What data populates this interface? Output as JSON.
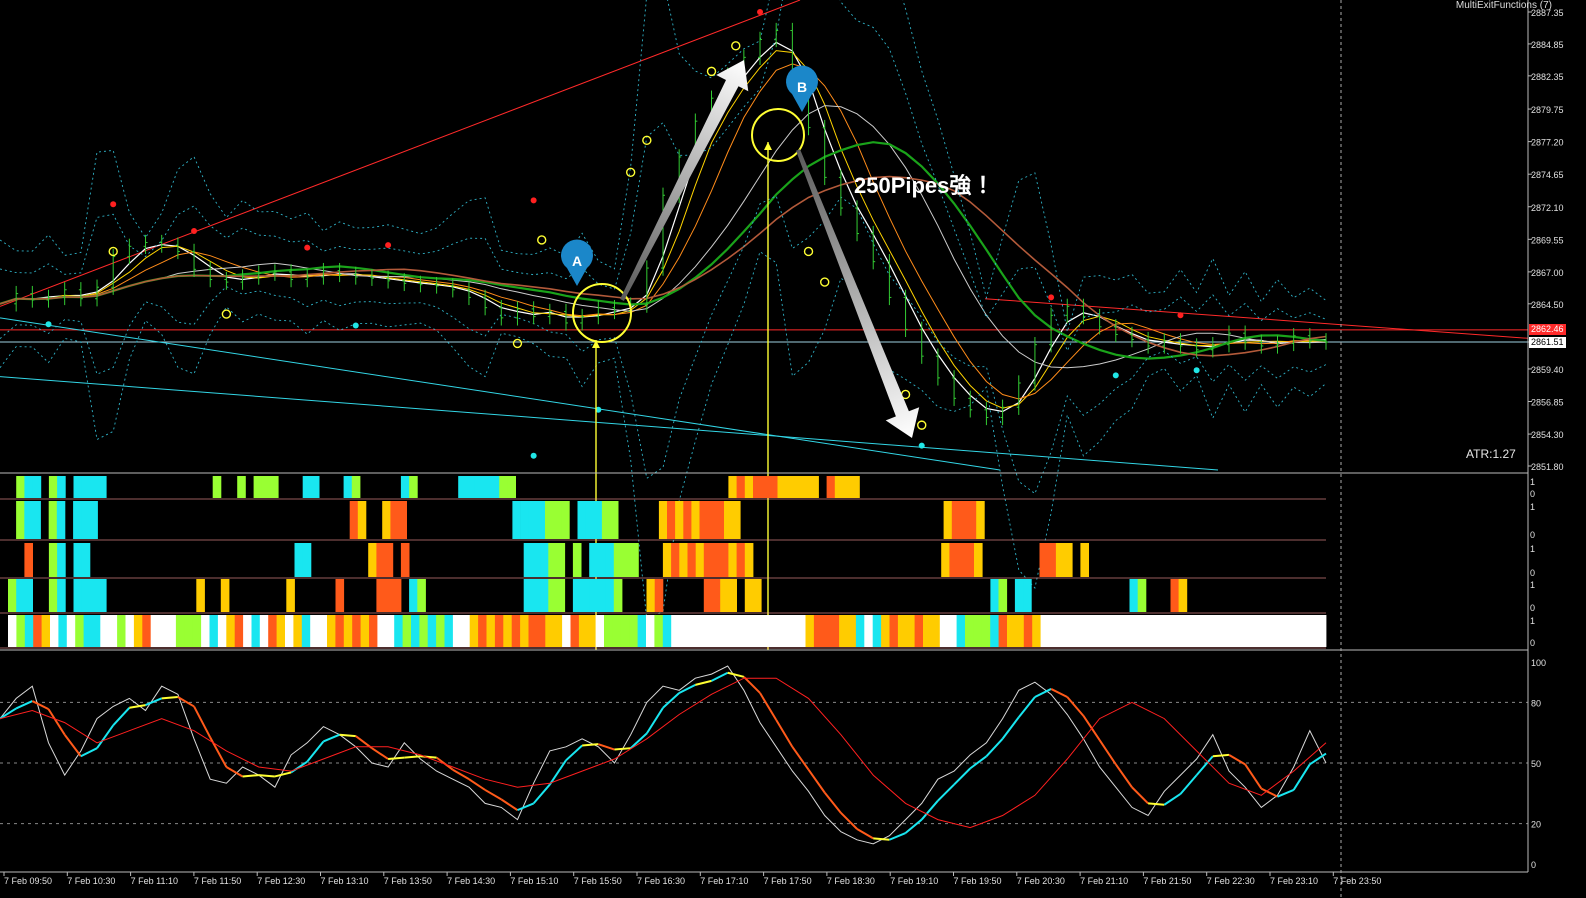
{
  "window": {
    "indicator_name": "MultiExitFunctions (7)",
    "atr_label": "ATR:1.27"
  },
  "annotations": {
    "main_text": "250Pipes強 ！",
    "pin_a": "A",
    "pin_b": "B"
  },
  "colors": {
    "background": "#000000",
    "candle": "#33cc33",
    "red_line": "#ff2a2a",
    "cyan_line": "#33d6e6",
    "yellow": "#ffff33",
    "orange": "#ff5a1a",
    "lime": "#99ff33",
    "gold": "#ffcc00"
  },
  "chart_data": [
    {
      "type": "line",
      "title": "",
      "y_axis_ticks": [
        "2887.35",
        "2884.85",
        "2882.35",
        "2879.75",
        "2877.20",
        "2874.65",
        "2872.10",
        "2869.55",
        "2867.00",
        "2864.50",
        "2861.51",
        "2859.40",
        "2856.85",
        "2854.30",
        "2851.80"
      ],
      "current_price_tags": [
        "2862.46",
        "2861.51"
      ],
      "ylim": [
        2851.8,
        2887.35
      ],
      "x_axis_ticks": [
        "7 Feb 09:50",
        "7 Feb 10:30",
        "7 Feb 11:10",
        "7 Feb 11:50",
        "7 Feb 12:30",
        "7 Feb 13:10",
        "7 Feb 13:50",
        "7 Feb 14:30",
        "7 Feb 15:10",
        "7 Feb 15:50",
        "7 Feb 16:30",
        "7 Feb 17:10",
        "7 Feb 17:50",
        "7 Feb 18:30",
        "7 Feb 19:10",
        "7 Feb 19:50",
        "7 Feb 20:30",
        "7 Feb 21:10",
        "7 Feb 21:50",
        "7 Feb 22:30",
        "7 Feb 23:10",
        "7 Feb 23:50"
      ],
      "series": [
        {
          "x": [
            0,
            4,
            8,
            12,
            16,
            20,
            24,
            28,
            32,
            36,
            40,
            44,
            48,
            52,
            56,
            60,
            64,
            68,
            72,
            76,
            80,
            84,
            88,
            92,
            96,
            100,
            104,
            108,
            112,
            116,
            120,
            124,
            128,
            132,
            136,
            140,
            144,
            148,
            152,
            156,
            160,
            164,
            168,
            172,
            176,
            180,
            184,
            188,
            192,
            196,
            200,
            204,
            208,
            212,
            216,
            220,
            224,
            228,
            232,
            236,
            240,
            244,
            248,
            252,
            256,
            260,
            264,
            268,
            272,
            276,
            280,
            284,
            288,
            292,
            296,
            300,
            304,
            308,
            312,
            316,
            320,
            324,
            328
          ],
          "values": [
            2864.5,
            2865.3,
            2864.8,
            2865.0,
            2865.6,
            2864.9,
            2865.8,
            2868.2,
            2869.0,
            2869.3,
            2869.1,
            2868.6,
            2867.2,
            2866.4,
            2866.2,
            2866.6,
            2866.9,
            2867.0,
            2866.4,
            2866.6,
            2867.1,
            2866.8,
            2866.6,
            2866.5,
            2866.3,
            2866.1,
            2866.0,
            2865.9,
            2865.6,
            2865.0,
            2864.2,
            2863.4,
            2864.1,
            2863.5,
            2863.9,
            2863.0,
            2863.5,
            2864.2,
            2863.9,
            2864.4,
            2867.3,
            2873.0,
            2876.0,
            2878.8,
            2880.6,
            2882.4,
            2883.8,
            2885.2,
            2885.9,
            2881.8,
            2878.3,
            2874.4,
            2872.0,
            2870.0,
            2867.8,
            2865.0,
            2862.5,
            2860.4,
            2858.7,
            2857.1,
            2856.2,
            2855.6,
            2856.4,
            2858.3,
            2861.3,
            2863.6,
            2864.3,
            2863.5,
            2862.7,
            2862.1,
            2861.7,
            2861.2,
            2861.6,
            2861.2,
            2860.9,
            2861.3,
            2862.2,
            2861.5,
            2861.2,
            2861.4,
            2862.0,
            2861.6,
            2861.5
          ]
        }
      ]
    },
    {
      "type": "heatmap",
      "title": "",
      "rows": 5,
      "row_axis_labels": [
        [
          "1",
          "0"
        ],
        [
          "1",
          "0"
        ],
        [
          "1",
          "0"
        ],
        [
          "1",
          "0"
        ],
        [
          "1",
          "0"
        ]
      ]
    },
    {
      "type": "line",
      "title": "",
      "y_axis_ticks": [
        "100",
        "80",
        "50",
        "20",
        "0"
      ],
      "ylim": [
        0,
        100
      ],
      "series": [
        {
          "x": [
            0,
            4,
            8,
            12,
            16,
            20,
            24,
            28,
            32,
            36,
            40,
            44,
            48,
            52,
            56,
            60,
            64,
            68,
            72,
            76,
            80,
            84,
            88,
            92,
            96,
            100,
            104,
            108,
            112,
            116,
            120,
            124,
            128,
            132,
            136,
            140,
            144,
            148,
            152,
            156,
            160,
            164,
            168,
            172,
            176,
            180,
            184,
            188,
            192,
            196,
            200,
            204,
            208,
            212,
            216,
            220,
            224,
            228,
            232,
            236,
            240,
            244,
            248,
            252,
            256,
            260,
            264,
            268,
            272,
            276,
            280,
            284,
            288,
            292,
            296,
            300,
            304,
            308,
            312,
            316,
            320,
            324,
            328
          ],
          "values": [
            72,
            82,
            88,
            60,
            44,
            56,
            72,
            78,
            82,
            76,
            88,
            84,
            62,
            42,
            40,
            48,
            44,
            38,
            54,
            60,
            68,
            64,
            58,
            50,
            48,
            60,
            52,
            46,
            42,
            38,
            30,
            28,
            22,
            40,
            56,
            58,
            62,
            58,
            50,
            64,
            80,
            88,
            86,
            92,
            94,
            98,
            86,
            70,
            58,
            46,
            36,
            24,
            16,
            12,
            10,
            14,
            22,
            30,
            42,
            46,
            54,
            60,
            72,
            86,
            90,
            84,
            74,
            62,
            48,
            38,
            28,
            24,
            36,
            44,
            52,
            64,
            46,
            38,
            28,
            34,
            48,
            66,
            50
          ]
        },
        {
          "x": [
            0,
            8,
            16,
            24,
            32,
            40,
            48,
            56,
            64,
            72,
            80,
            88,
            96,
            104,
            112,
            120,
            128,
            136,
            144,
            152,
            160,
            168,
            176,
            184,
            192,
            200,
            208,
            216,
            224,
            232,
            240,
            248,
            256,
            264,
            272,
            280,
            288,
            296,
            304,
            312,
            320,
            328
          ],
          "values": [
            72,
            76,
            70,
            60,
            66,
            72,
            66,
            56,
            48,
            46,
            52,
            58,
            58,
            54,
            48,
            42,
            38,
            40,
            46,
            52,
            62,
            74,
            84,
            92,
            92,
            82,
            64,
            44,
            30,
            22,
            18,
            24,
            34,
            52,
            72,
            80,
            72,
            56,
            40,
            34,
            46,
            60
          ]
        }
      ]
    }
  ]
}
